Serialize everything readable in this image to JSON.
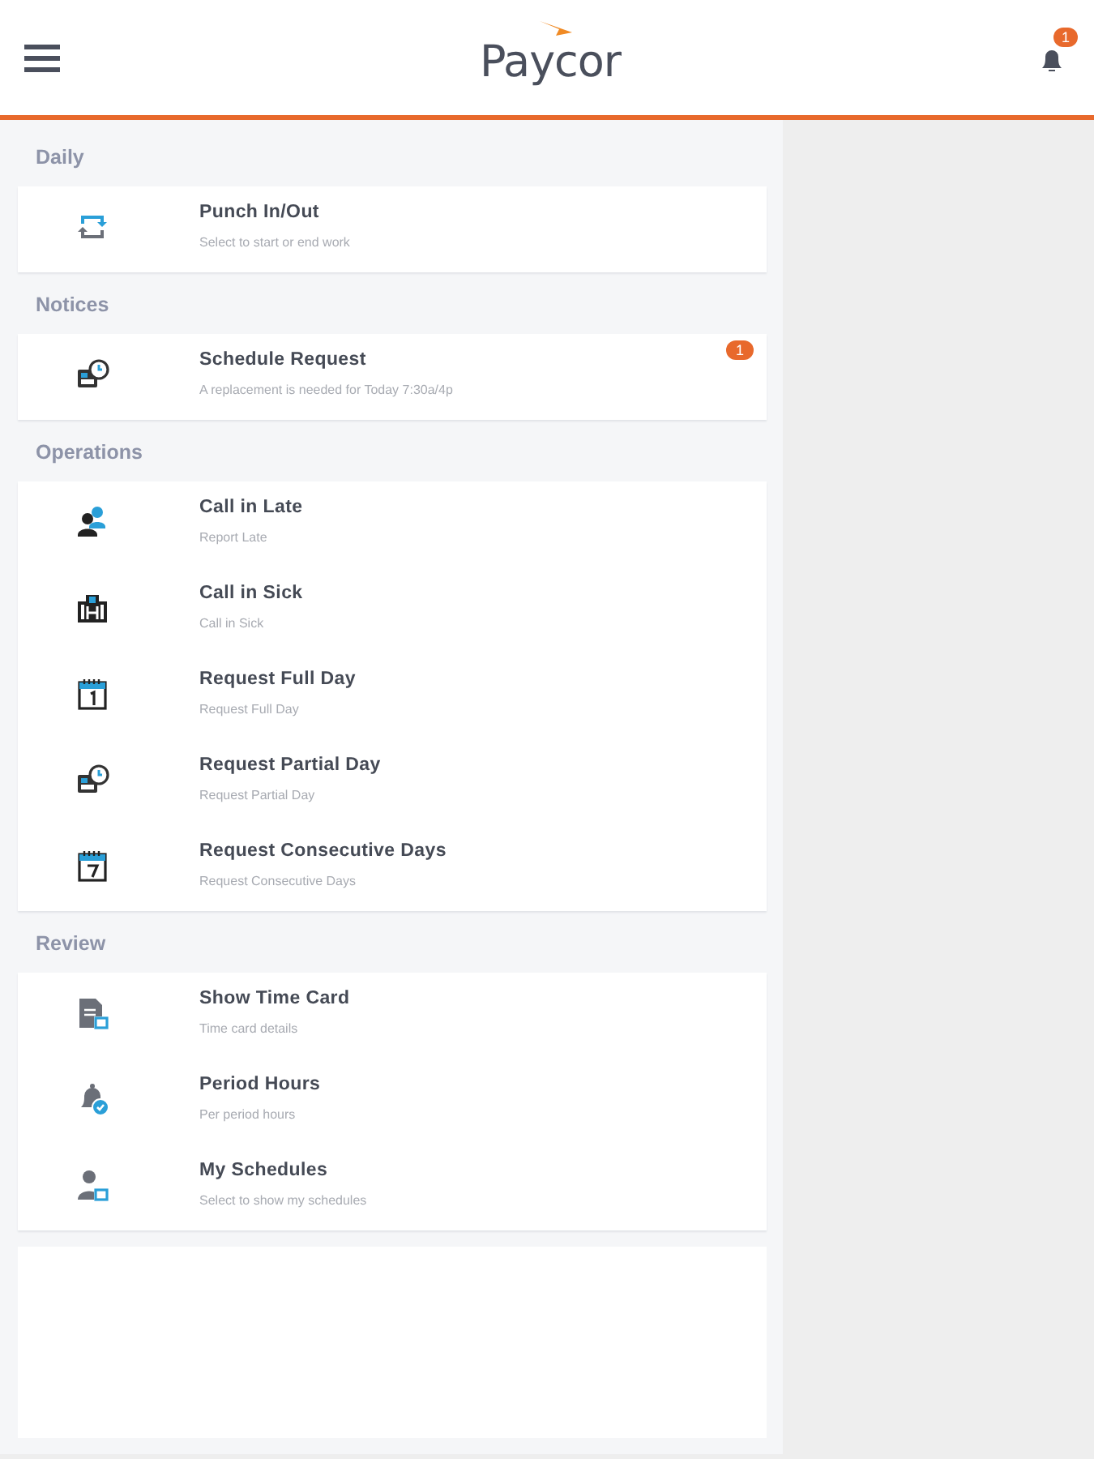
{
  "header": {
    "logo": "Paycor",
    "notification_count": "1"
  },
  "sections": [
    {
      "title": "Daily",
      "items": [
        {
          "kind": "sync",
          "title": "Punch In/Out",
          "subtitle": "Select to start or end work"
        }
      ]
    },
    {
      "title": "Notices",
      "items": [
        {
          "kind": "schedule",
          "title": "Schedule Request",
          "subtitle": "A replacement is needed for Today 7:30a/4p",
          "badge": "1"
        }
      ]
    },
    {
      "title": "Operations",
      "items": [
        {
          "kind": "late",
          "title": "Call in Late",
          "subtitle": "Report Late"
        },
        {
          "kind": "sick",
          "title": "Call in Sick",
          "subtitle": "Call in Sick"
        },
        {
          "kind": "day",
          "title": "Request Full Day",
          "subtitle": "Request Full Day"
        },
        {
          "kind": "schedule",
          "title": "Request Partial Day",
          "subtitle": "Request Partial Day"
        },
        {
          "kind": "days",
          "title": "Request Consecutive Days",
          "subtitle": "Request Consecutive Days"
        }
      ]
    },
    {
      "title": "Review",
      "items": [
        {
          "kind": "timecard",
          "title": "Show Time Card",
          "subtitle": "Time card details"
        },
        {
          "kind": "hours",
          "title": "Period Hours",
          "subtitle": "Per period hours"
        },
        {
          "kind": "schedules",
          "title": "My Schedules",
          "subtitle": "Select to show my schedules"
        }
      ]
    }
  ]
}
